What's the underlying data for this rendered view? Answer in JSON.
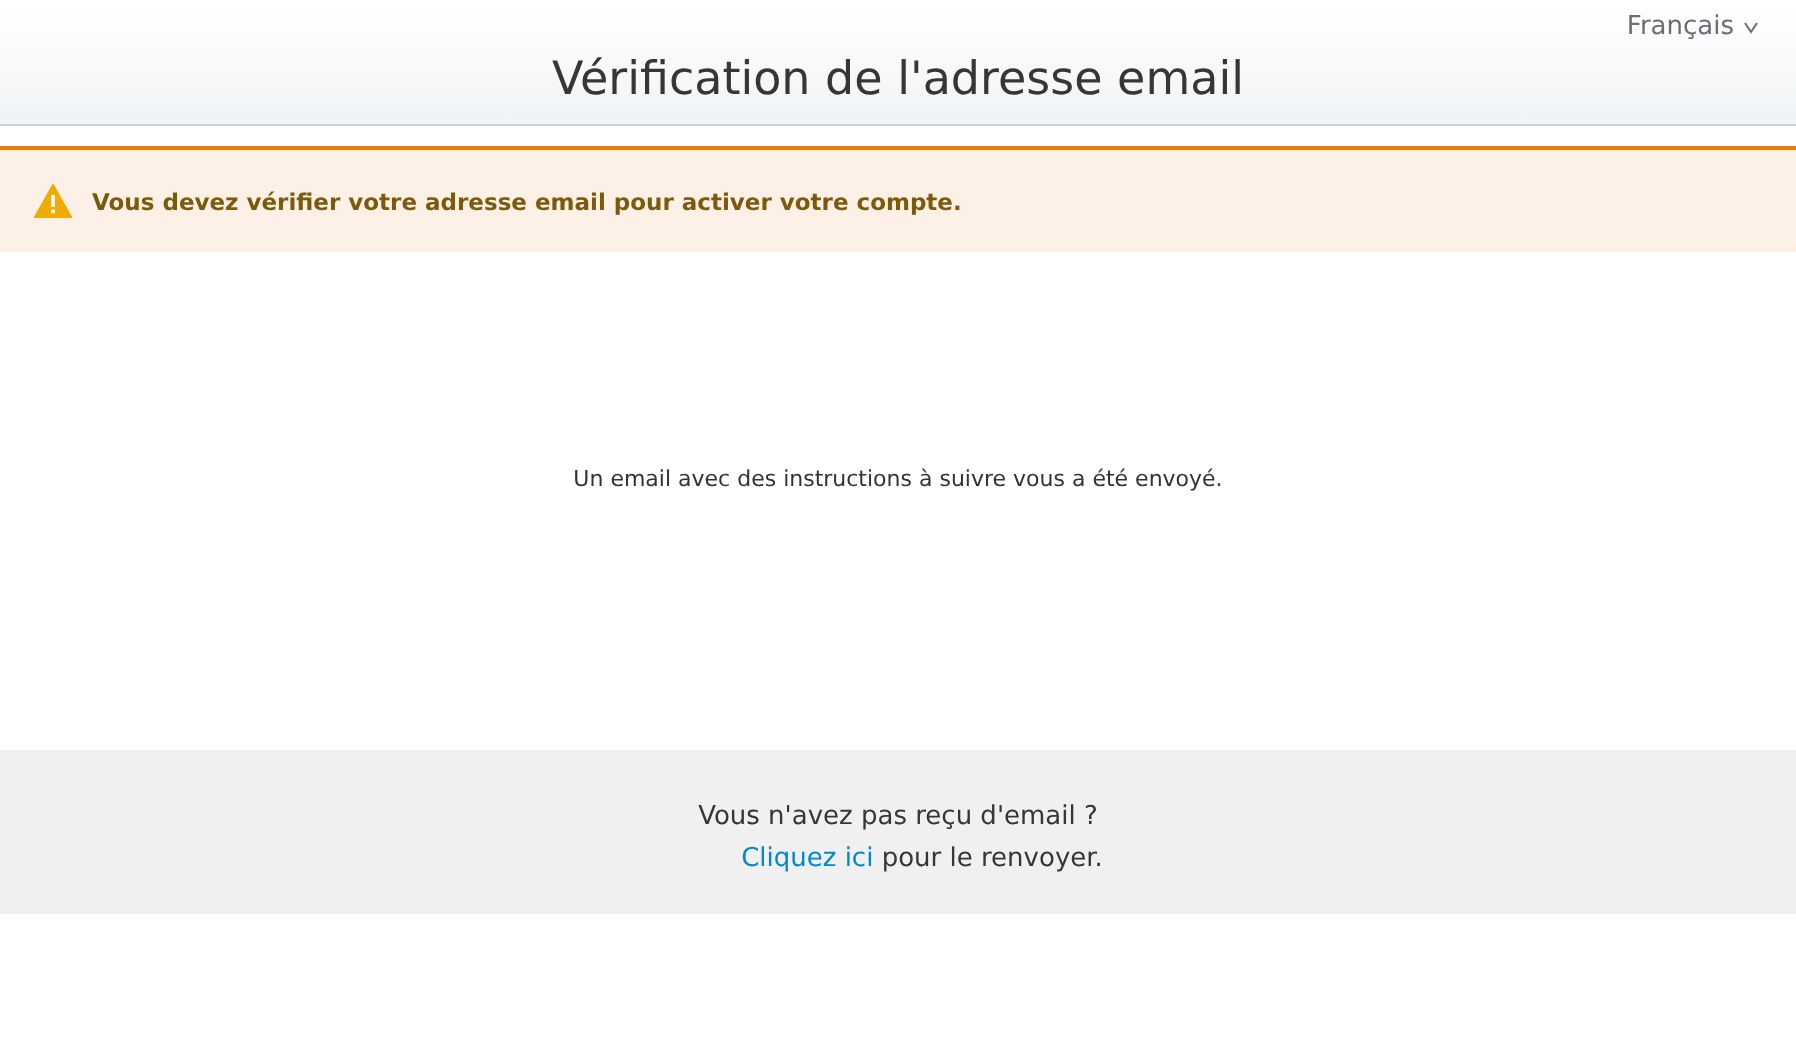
{
  "header": {
    "title": "Vérification de l'adresse email",
    "language": "Français"
  },
  "alert": {
    "kind": "warning",
    "message": "Vous devez vérifier votre adresse email pour activer votre compte."
  },
  "instructions": "Un email avec des instructions à suivre vous a été envoyé.",
  "footer": {
    "question": "Vous n'avez pas reçu d'email ?",
    "link": "Cliquez ici",
    "link_suffix": "pour le renvoyer."
  }
}
